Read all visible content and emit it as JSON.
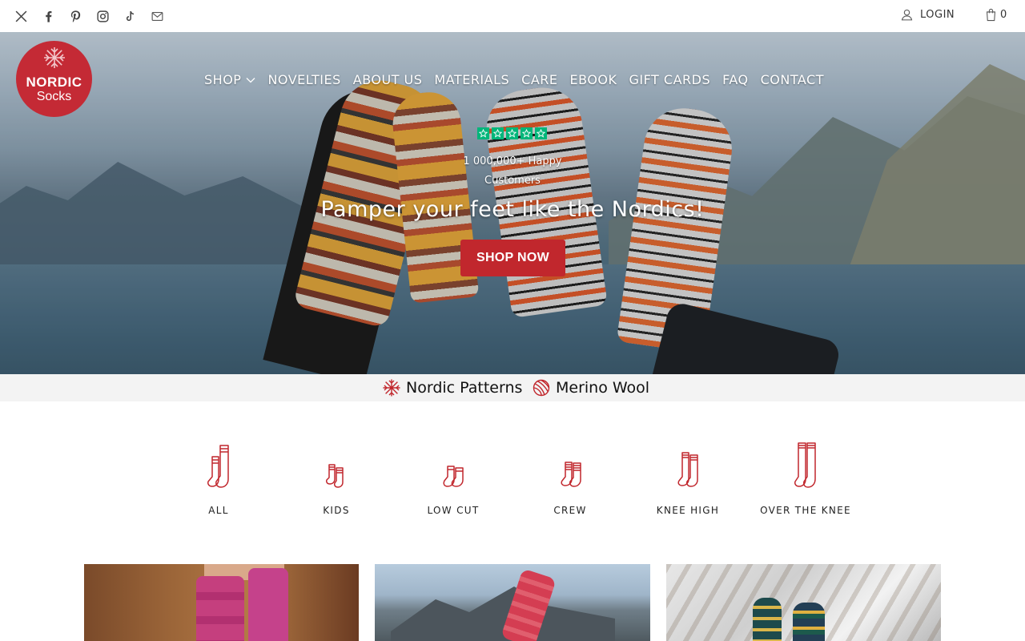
{
  "topbar": {
    "social_icons": [
      "x-twitter-icon",
      "facebook-icon",
      "pinterest-icon",
      "instagram-icon",
      "tiktok-icon",
      "email-icon"
    ],
    "login_label": "LOGIN",
    "cart_count": "0"
  },
  "logo": {
    "line1": "NORDIC",
    "line2": "Socks"
  },
  "nav": {
    "items": [
      "SHOP",
      "NOVELTIES",
      "ABOUT US",
      "MATERIALS",
      "CARE",
      "EBOOK",
      "GIFT CARDS",
      "FAQ",
      "CONTACT"
    ]
  },
  "hero": {
    "rating_stars": 5,
    "happy_line1": "1 000,000+ Happy",
    "happy_line2": "Customers",
    "tagline": "Pamper your feet like the Nordics!",
    "cta_label": "SHOP NOW"
  },
  "features": [
    {
      "label": "Nordic Patterns",
      "icon": "snowflake-icon"
    },
    {
      "label": "Merino Wool",
      "icon": "yarn-ball-icon"
    }
  ],
  "categories": [
    {
      "label": "ALL",
      "icon": "two-tall-socks-icon"
    },
    {
      "label": "KIDS",
      "icon": "kids-socks-icon"
    },
    {
      "label": "LOW CUT",
      "icon": "low-cut-socks-icon"
    },
    {
      "label": "CREW",
      "icon": "crew-socks-icon"
    },
    {
      "label": "KNEE HIGH",
      "icon": "knee-high-socks-icon"
    },
    {
      "label": "OVER THE KNEE",
      "icon": "over-the-knee-socks-icon"
    }
  ],
  "colors": {
    "brand_red": "#c1272d",
    "trust_green": "#00b67a",
    "strip_bg": "#f3f3f3"
  }
}
